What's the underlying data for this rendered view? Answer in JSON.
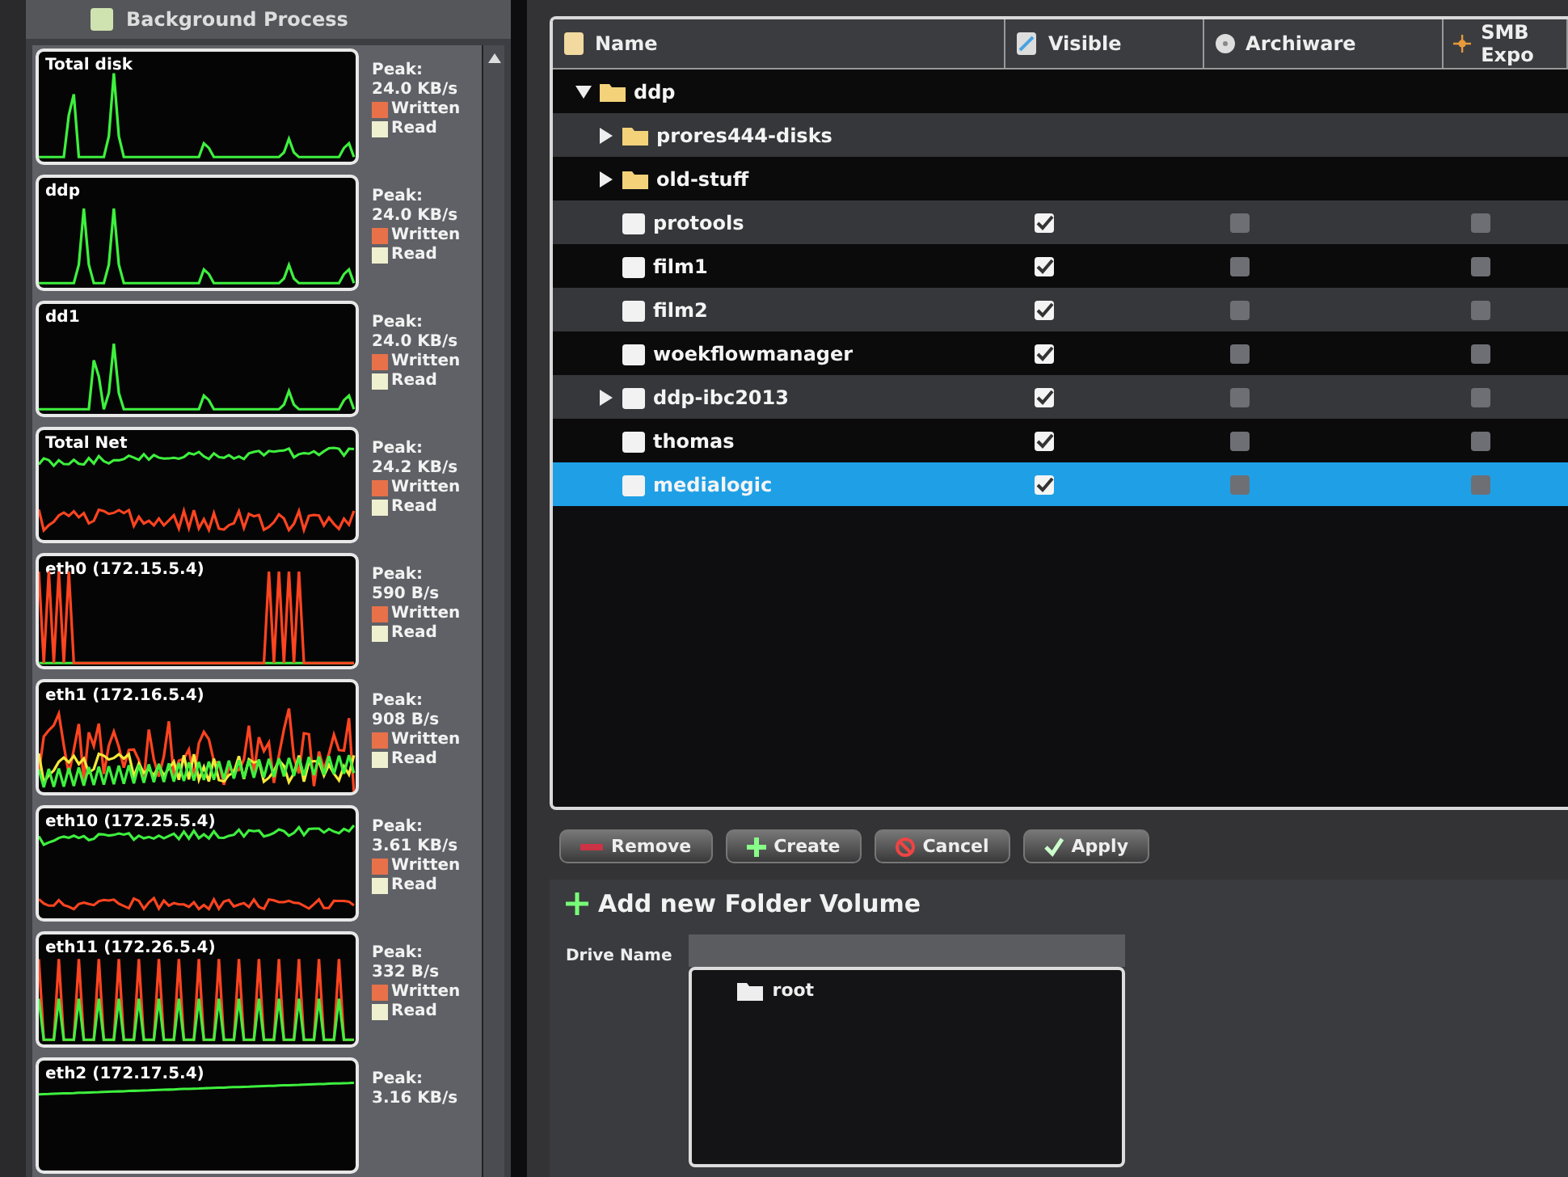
{
  "monitor": {
    "title": "Background Process",
    "graphs": [
      {
        "title": "Total disk",
        "kind": "spikes",
        "peak_label": "Peak:",
        "peak": "24.0 KB/s",
        "legend": [
          "Written",
          "Read"
        ]
      },
      {
        "title": "ddp",
        "kind": "spikes",
        "peak_label": "Peak:",
        "peak": "24.0 KB/s",
        "legend": [
          "Written",
          "Read"
        ]
      },
      {
        "title": "dd1",
        "kind": "spikes",
        "peak_label": "Peak:",
        "peak": "24.0 KB/s",
        "legend": [
          "Written",
          "Read"
        ]
      },
      {
        "title": "Total Net",
        "kind": "dual-noise",
        "peak_label": "Peak:",
        "peak": "24.2 KB/s",
        "legend": [
          "Written",
          "Read"
        ]
      },
      {
        "title": "eth0 (172.15.5.4)",
        "kind": "bursts",
        "peak_label": "Peak:",
        "peak": "590 B/s",
        "legend": [
          "Written",
          "Read"
        ]
      },
      {
        "title": "eth1 (172.16.5.4)",
        "kind": "mixed",
        "peak_label": "Peak:",
        "peak": "908 B/s",
        "legend": [
          "Written",
          "Read"
        ]
      },
      {
        "title": "eth10 (172.25.5.4)",
        "kind": "dual-noise",
        "peak_label": "Peak:",
        "peak": "3.61 KB/s",
        "legend": [
          "Written",
          "Read"
        ]
      },
      {
        "title": "eth11 (172.26.5.4)",
        "kind": "bars",
        "peak_label": "Peak:",
        "peak": "332 B/s",
        "legend": [
          "Written",
          "Read"
        ]
      },
      {
        "title": "eth2 (172.17.5.4)",
        "kind": "flat",
        "peak_label": "Peak:",
        "peak": "3.16 KB/s"
      }
    ]
  },
  "table": {
    "columns": [
      "Name",
      "Visible",
      "Archiware",
      "SMB Expo"
    ],
    "rows": [
      {
        "name": "ddp",
        "kind": "folder",
        "expanded": true,
        "selected": false,
        "children": [
          {
            "name": "prores444-disks",
            "kind": "folder",
            "expanded": false,
            "selected": false
          },
          {
            "name": "old-stuff",
            "kind": "folder",
            "expanded": false,
            "selected": false
          },
          {
            "name": "protools",
            "kind": "share",
            "selected": false,
            "visible": true,
            "archiware": false,
            "smb": false
          },
          {
            "name": "film1",
            "kind": "share",
            "selected": false,
            "visible": true,
            "archiware": false,
            "smb": false
          },
          {
            "name": "film2",
            "kind": "share",
            "selected": false,
            "visible": true,
            "archiware": false,
            "smb": false
          },
          {
            "name": "woekflowmanager",
            "kind": "share",
            "selected": false,
            "visible": true,
            "archiware": false,
            "smb": false
          },
          {
            "name": "ddp-ibc2013",
            "kind": "share",
            "expanded": false,
            "selected": false,
            "visible": true,
            "archiware": false,
            "smb": false
          },
          {
            "name": "thomas",
            "kind": "share",
            "selected": false,
            "visible": true,
            "archiware": false,
            "smb": false
          },
          {
            "name": "medialogic",
            "kind": "share",
            "selected": true,
            "visible": true,
            "archiware": false,
            "smb": false
          }
        ]
      }
    ]
  },
  "buttons": [
    {
      "label": "Remove",
      "kind": "remove"
    },
    {
      "label": "Create",
      "kind": "create"
    },
    {
      "label": "Cancel",
      "kind": "cancel"
    },
    {
      "label": "Apply",
      "kind": "apply"
    }
  ],
  "add_volume": {
    "title": "Add new Folder Volume",
    "drive_label": "Drive Name",
    "tree": [
      {
        "name": "root"
      }
    ]
  }
}
